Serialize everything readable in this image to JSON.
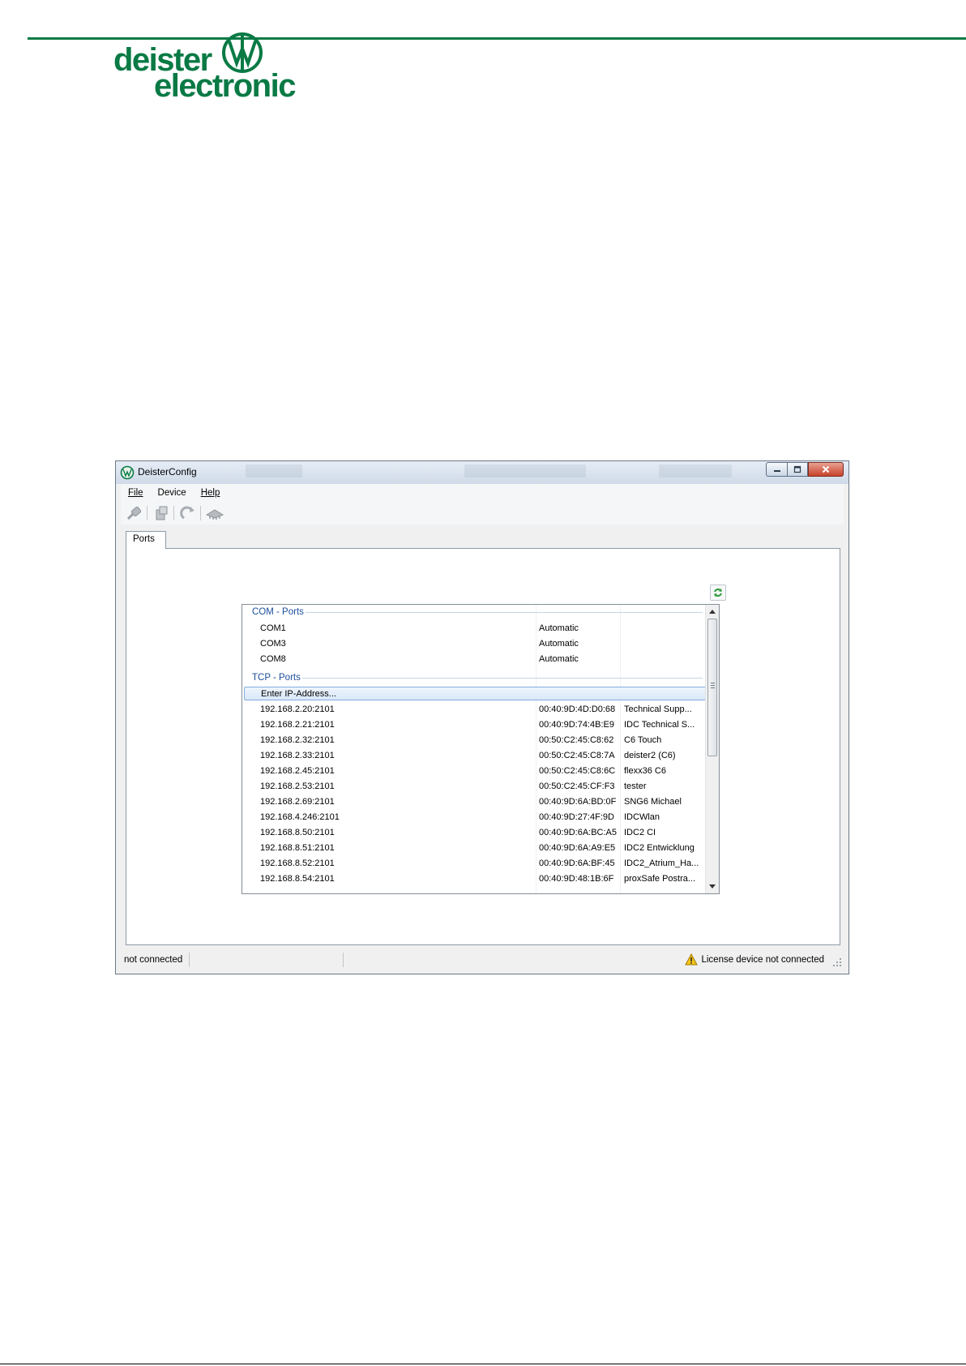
{
  "logo": {
    "line1": "deister",
    "line2": "electronic"
  },
  "window": {
    "title": "DeisterConfig",
    "menu": [
      "File",
      "Device",
      "Help"
    ],
    "toolbar_icons": [
      "connect-icon",
      "device-icon",
      "refresh-arrow-icon",
      "hardware-icon"
    ],
    "tab": "Ports"
  },
  "ports": {
    "com_header": "COM - Ports",
    "com": [
      {
        "name": "COM1",
        "mode": "Automatic"
      },
      {
        "name": "COM3",
        "mode": "Automatic"
      },
      {
        "name": "COM8",
        "mode": "Automatic"
      }
    ],
    "tcp_header": "TCP - Ports",
    "enter_ip": "Enter IP-Address...",
    "tcp": [
      {
        "address": "192.168.2.20:2101",
        "mac": "00:40:9D:4D:D0:68",
        "name": "Technical Supp..."
      },
      {
        "address": "192.168.2.21:2101",
        "mac": "00:40:9D:74:4B:E9",
        "name": "IDC Technical S..."
      },
      {
        "address": "192.168.2.32:2101",
        "mac": "00:50:C2:45:C8:62",
        "name": "C6 Touch"
      },
      {
        "address": "192.168.2.33:2101",
        "mac": "00:50:C2:45:C8:7A",
        "name": "deister2 (C6)"
      },
      {
        "address": "192.168.2.45:2101",
        "mac": "00:50:C2:45:C8:6C",
        "name": "flexx36 C6"
      },
      {
        "address": "192.168.2.53:2101",
        "mac": "00:50:C2:45:CF:F3",
        "name": "tester"
      },
      {
        "address": "192.168.2.69:2101",
        "mac": "00:40:9D:6A:BD:0F",
        "name": "SNG6 Michael"
      },
      {
        "address": "192.168.4.246:2101",
        "mac": "00:40:9D:27:4F:9D",
        "name": "IDCWlan"
      },
      {
        "address": "192.168.8.50:2101",
        "mac": "00:40:9D:6A:BC:A5",
        "name": "IDC2 CI"
      },
      {
        "address": "192.168.8.51:2101",
        "mac": "00:40:9D:6A:A9:E5",
        "name": "IDC2 Entwicklung"
      },
      {
        "address": "192.168.8.52:2101",
        "mac": "00:40:9D:6A:BF:45",
        "name": "IDC2_Atrium_Ha..."
      },
      {
        "address": "192.168.8.54:2101",
        "mac": "00:40:9D:48:1B:6F",
        "name": "proxSafe Postra..."
      }
    ]
  },
  "status": {
    "connection": "not connected",
    "license": "License device not connected"
  }
}
